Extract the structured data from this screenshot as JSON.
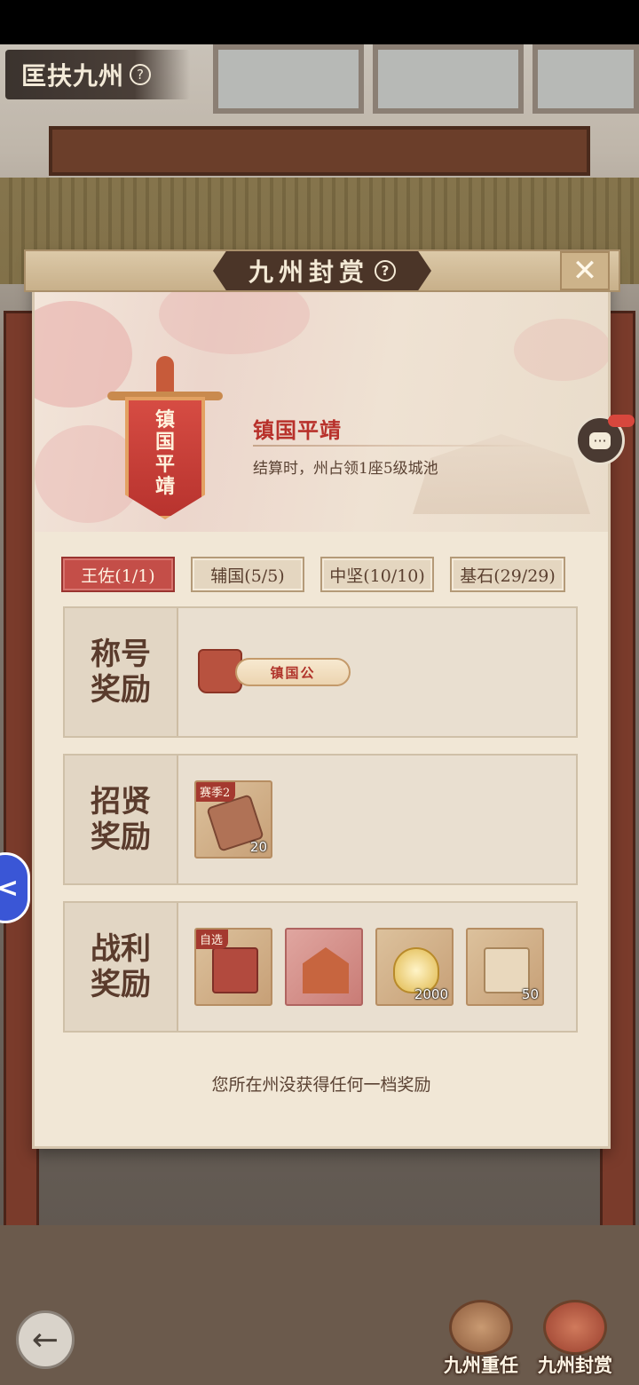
{
  "screen": {
    "title": "匡扶九州",
    "help_mark": "?"
  },
  "dialog": {
    "title": "九州封赏",
    "help_mark": "?",
    "close_glyph": "✕",
    "emblem_text": "镇国平靖",
    "achievement_name": "镇国平靖",
    "achievement_desc": "结算时，州占领1座5级城池",
    "tabs": [
      {
        "label": "王佐(1/1)",
        "active": true
      },
      {
        "label": "辅国(5/5)",
        "active": false
      },
      {
        "label": "中坚(10/10)",
        "active": false
      },
      {
        "label": "基石(29/29)",
        "active": false
      }
    ],
    "sections": {
      "title_reward": {
        "label": "称号奖励",
        "item": {
          "name": "镇国公"
        }
      },
      "recruit_reward": {
        "label": "招贤奖励",
        "items": [
          {
            "tag": "赛季2",
            "count": "20",
            "icon": "token-plaque-icon"
          }
        ]
      },
      "spoils_reward": {
        "label": "战利奖励",
        "items": [
          {
            "tag": "自选",
            "count": "",
            "icon": "selectable-chest-icon"
          },
          {
            "tag": "",
            "count": "",
            "icon": "palace-chest-icon"
          },
          {
            "tag": "",
            "count": "2000",
            "icon": "gold-ingot-icon"
          },
          {
            "tag": "",
            "count": "50",
            "icon": "scroll-pack-icon"
          }
        ]
      }
    },
    "footer_note": "您所在州没获得任何一档奖励"
  },
  "chat": {
    "dots": "···"
  },
  "side_tab": {
    "glyph": "<"
  },
  "bottom_nav": {
    "back_glyph": "←",
    "items": [
      {
        "label": "九州重任",
        "icon": "mission-icon"
      },
      {
        "label": "九州封赏",
        "icon": "reward-chest-icon"
      }
    ]
  },
  "colors": {
    "accent_red": "#c44e48",
    "title_red": "#b8312b",
    "panel": "#f1e7d6",
    "header_dark": "#4b3528"
  }
}
